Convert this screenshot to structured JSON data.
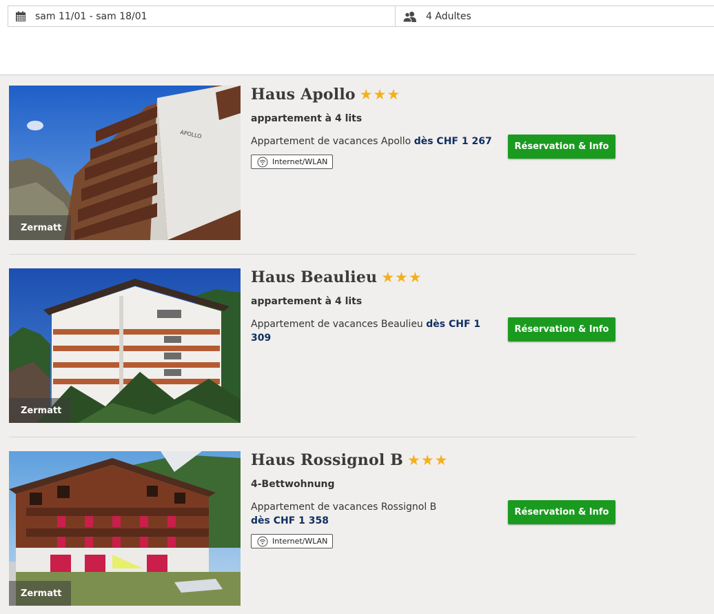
{
  "search": {
    "dates": "sam 11/01 - sam 18/01",
    "dates_icon": "calendar-icon",
    "guests": "4 Adultes",
    "guests_icon": "people-icon"
  },
  "colors": {
    "cta_green": "#1a9b1f",
    "star_gold": "#f3b01e",
    "price_navy": "#0f2f63"
  },
  "listings": [
    {
      "title": "Haus Apollo",
      "stars": "★★★",
      "subtitle": "appartement à 4 lits",
      "description": "Appartement de vacances Apollo",
      "price": "dès CHF 1 267",
      "location": "Zermatt",
      "amenity": "Internet/WLAN",
      "button": "Réservation & Info"
    },
    {
      "title": "Haus Beaulieu",
      "stars": "★★★",
      "subtitle": "appartement à 4 lits",
      "description": "Appartement de vacances Beaulieu",
      "price": "dès CHF 1 309",
      "location": "Zermatt",
      "button": "Réservation & Info"
    },
    {
      "title": "Haus Rossignol B",
      "stars": "★★★",
      "subtitle": "4-Bettwohnung",
      "description": "Appartement de vacances Rossignol B",
      "price": "dès CHF 1 358",
      "location": "Zermatt",
      "amenity": "Internet/WLAN",
      "button": "Réservation & Info"
    }
  ]
}
